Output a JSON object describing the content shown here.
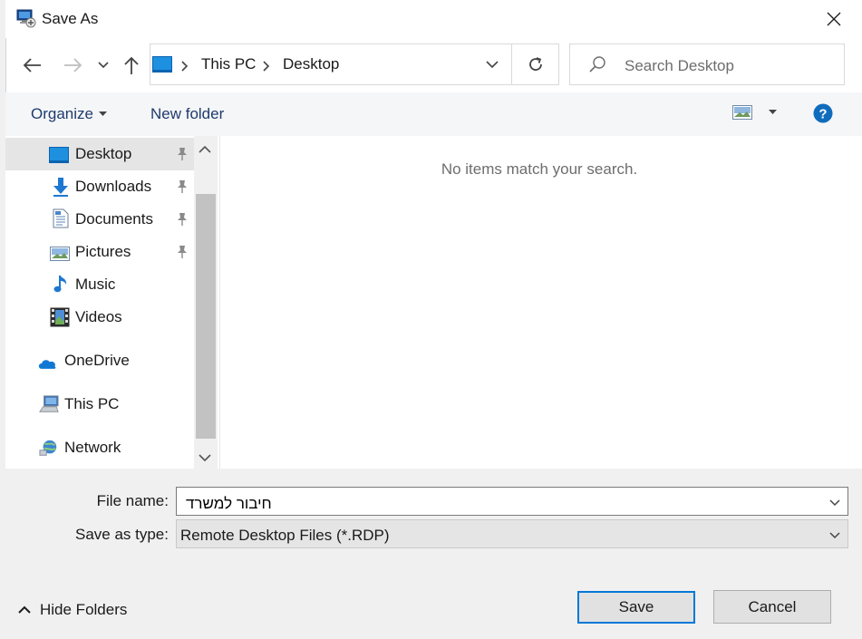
{
  "window": {
    "title": "Save As"
  },
  "address": {
    "crumbs": [
      "This PC",
      "Desktop"
    ]
  },
  "search": {
    "placeholder": "Search Desktop"
  },
  "toolbar": {
    "organize_label": "Organize",
    "new_folder_label": "New folder"
  },
  "nav": {
    "quick_access": [
      {
        "label": "Desktop",
        "icon": "desktop-icon",
        "pinned": true,
        "selected": true
      },
      {
        "label": "Downloads",
        "icon": "download-icon",
        "pinned": true
      },
      {
        "label": "Documents",
        "icon": "document-icon",
        "pinned": true
      },
      {
        "label": "Pictures",
        "icon": "picture-icon",
        "pinned": true
      },
      {
        "label": "Music",
        "icon": "music-icon",
        "pinned": false
      },
      {
        "label": "Videos",
        "icon": "video-icon",
        "pinned": false
      }
    ],
    "locations": [
      {
        "label": "OneDrive",
        "icon": "cloud-icon"
      },
      {
        "label": "This PC",
        "icon": "computer-icon"
      },
      {
        "label": "Network",
        "icon": "network-icon"
      }
    ]
  },
  "content": {
    "empty_message": "No items match your search."
  },
  "form": {
    "file_name_label": "File name:",
    "file_name_value": "חיבור למשרד",
    "save_type_label": "Save as type:",
    "save_type_value": "Remote Desktop Files (*.RDP)"
  },
  "footer": {
    "hide_folders_label": "Hide Folders",
    "save_label": "Save",
    "cancel_label": "Cancel"
  },
  "colors": {
    "accent": "#0078d7",
    "folder_blue": "#1e90e0"
  }
}
